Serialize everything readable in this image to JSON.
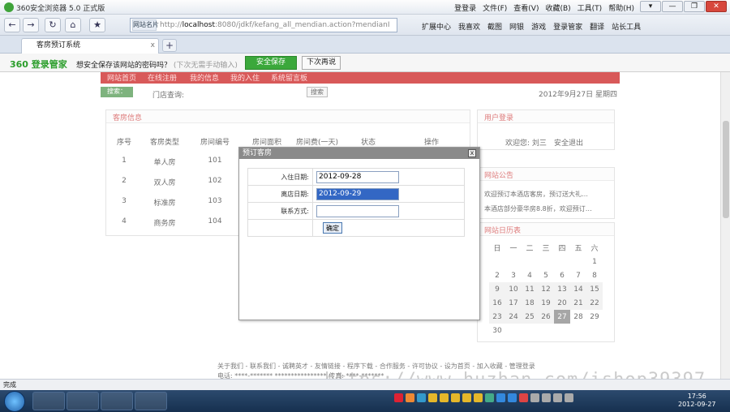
{
  "browser": {
    "title": "360安全浏览器 5.0 正式版",
    "menus": [
      "登登录",
      "文件(F)",
      "查看(V)",
      "收藏(B)",
      "工具(T)",
      "帮助(H)"
    ],
    "window_buttons": [
      "▾",
      "—",
      "❐",
      "✕"
    ],
    "nav_buttons": [
      "←",
      "→",
      "↻",
      "⌂",
      "★"
    ],
    "url_prefix": "网站名片",
    "url_host": "localhost",
    "url_rest": ":8080/jdkf/kefang_all_mendian.action?mendianI",
    "toolbar": [
      "扩展中心",
      "我喜欢",
      "截图",
      "网银",
      "游戏",
      "登录管家",
      "翻译",
      "站长工具"
    ],
    "tab_title": "客房预订系统",
    "tab_close": "x",
    "new_tab": "+"
  },
  "password_bar": {
    "logo": "360 登录管家",
    "message": "想安全保存该网站的密码吗？",
    "hint": "(下次无需手动输入)",
    "save_label": "安全保存",
    "later_label": "下次再说"
  },
  "site": {
    "nav": [
      "网站首页",
      "在线注册",
      "我的信息",
      "我的入住",
      "系统留言板"
    ],
    "search_label": "搜索：",
    "store_query_label": "门店查询:",
    "search_button": "搜索",
    "date_text": "2012年9月27日 星期四",
    "room_panel_title": "客房信息",
    "room_columns": [
      "序号",
      "客房类型",
      "房间编号",
      "房间面积",
      "房间费(一天)",
      "状态",
      "操作"
    ],
    "rooms": [
      {
        "no": "1",
        "type": "单人房",
        "room": "101"
      },
      {
        "no": "2",
        "type": "双人房",
        "room": "102"
      },
      {
        "no": "3",
        "type": "标准房",
        "room": "103"
      },
      {
        "no": "4",
        "type": "商务房",
        "room": "104"
      }
    ],
    "user_panel_title": "用户登录",
    "welcome": "欢迎您:  刘三",
    "logout": "安全退出",
    "notice_panel_title": "网站公告",
    "notices": [
      "欢迎预订本酒店客房，预订送大礼…",
      "本酒店部分豪华房8.8折，欢迎预订…"
    ],
    "calendar_title": "网站日历表",
    "weekdays": [
      "日",
      "一",
      "二",
      "三",
      "四",
      "五",
      "六"
    ],
    "calendar_rows": [
      [
        "",
        "",
        "",
        "",
        "",
        "",
        "1"
      ],
      [
        "2",
        "3",
        "4",
        "5",
        "6",
        "7",
        "8"
      ],
      [
        "9",
        "10",
        "11",
        "12",
        "13",
        "14",
        "15"
      ],
      [
        "16",
        "17",
        "18",
        "19",
        "20",
        "21",
        "22"
      ],
      [
        "23",
        "24",
        "25",
        "26",
        "27",
        "28",
        "29"
      ],
      [
        "30",
        "",
        "",
        "",
        "",
        "",
        ""
      ]
    ],
    "today": "27",
    "footer_links": "关于我们 - 联系我们 - 诚聘英才 - 友情链接 - 程序下载 - 合作服务 - 许可协议 - 设为首页 - 加入收藏 - 管理登录",
    "footer_phone": "电话: ****-******* **************** 传真: ****-*******"
  },
  "dialog": {
    "title": "预订客房",
    "close": "x",
    "checkin_label": "入住日期:",
    "checkin_value": "2012-09-28",
    "checkout_label": "离店日期:",
    "checkout_value": "2012-09-29",
    "contact_label": "联系方式:",
    "contact_value": "",
    "ok_label": "确定"
  },
  "watermark": "https://www.huzhan.com/ishop39397",
  "status": "完成",
  "clock": {
    "time": "17:56",
    "date": "2012-09-27"
  },
  "colors": {
    "red_nav": "#c40000",
    "save_green": "#3ba83b",
    "panel_title": "#cc3333",
    "today_bg": "#777777"
  }
}
